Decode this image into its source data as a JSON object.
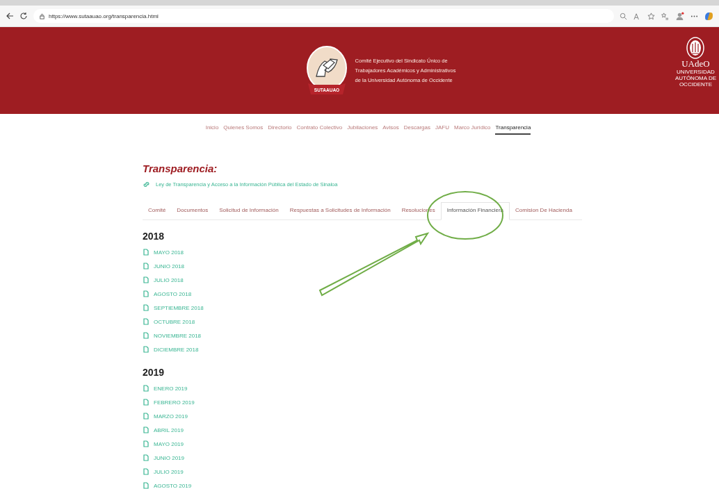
{
  "browser": {
    "url": "https://www.sutaauao.org/transparencia.html"
  },
  "header": {
    "logo_ribbon": "SUTAAUAO",
    "org_lines": [
      "Comité Ejecutivo del Sindicato Único de",
      "Trabajadores Académicos y Administrativos",
      "de la Universidad Autónoma de Occidente"
    ],
    "university_short": "UAdeO",
    "university_lines": [
      "UNIVERSIDAD",
      "AUTÓNOMA DE",
      "OCCIDENTE"
    ]
  },
  "nav": [
    {
      "label": "Inicio",
      "selected": false
    },
    {
      "label": "Quienes Somos",
      "selected": false
    },
    {
      "label": "Directorio",
      "selected": false
    },
    {
      "label": "Contrato Colectivo",
      "selected": false
    },
    {
      "label": "Jubilaciones",
      "selected": false
    },
    {
      "label": "Avisos",
      "selected": false
    },
    {
      "label": "Descargas",
      "selected": false
    },
    {
      "label": "JAFU",
      "selected": false
    },
    {
      "label": "Marco Jurídico",
      "selected": false
    },
    {
      "label": "Transparencia",
      "selected": true
    }
  ],
  "page_title": "Transparencia:",
  "law_link": "Ley de Transparencia y Acceso a la Información Pública del Estado de Sinaloa",
  "tabs": [
    {
      "label": "Comité",
      "selected": false
    },
    {
      "label": "Documentos",
      "selected": false
    },
    {
      "label": "Solicitud de Información",
      "selected": false
    },
    {
      "label": "Respuestas a Solicitudes de Información",
      "selected": false
    },
    {
      "label": "Resoluciones",
      "selected": false
    },
    {
      "label": "Información Financiera",
      "selected": true
    },
    {
      "label": "Comision De Hacienda",
      "selected": false
    }
  ],
  "years": [
    {
      "year": "2018",
      "files": [
        "MAYO 2018",
        "JUNIO 2018",
        "JULIO 2018",
        "AGOSTO 2018",
        "SEPTIEMBRE 2018",
        "OCTUBRE 2018",
        "NOVIEMBRE 2018",
        "DICIEMBRE 2018"
      ]
    },
    {
      "year": "2019",
      "files": [
        "ENERO 2019",
        "FEBRERO 2019",
        "MARZO 2019",
        "ABRIL 2019",
        "MAYO 2019",
        "JUNIO 2019",
        "JULIO 2019",
        "AGOSTO 2019"
      ]
    }
  ]
}
